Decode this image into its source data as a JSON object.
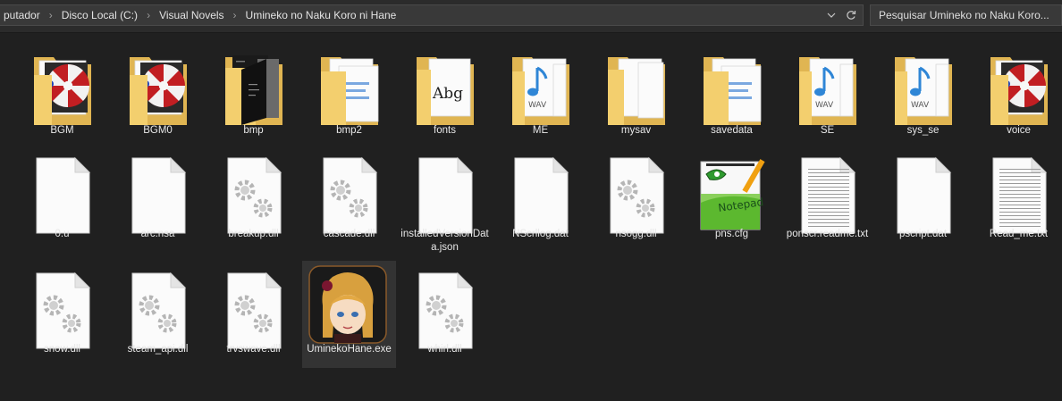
{
  "breadcrumb": {
    "items": [
      "putador",
      "Disco Local (C:)",
      "Visual Novels",
      "Umineko no Naku Koro ni Hane"
    ]
  },
  "search": {
    "placeholder": "Pesquisar Umineko no Naku Koro..."
  },
  "files": [
    {
      "name": "BGM",
      "type": "folder-app"
    },
    {
      "name": "BGM0",
      "type": "folder-app"
    },
    {
      "name": "bmp",
      "type": "folder-dark"
    },
    {
      "name": "bmp2",
      "type": "folder-docs"
    },
    {
      "name": "fonts",
      "type": "folder-font"
    },
    {
      "name": "ME",
      "type": "folder-wav"
    },
    {
      "name": "mysav",
      "type": "folder-plain"
    },
    {
      "name": "savedata",
      "type": "folder-docs"
    },
    {
      "name": "SE",
      "type": "folder-wav"
    },
    {
      "name": "sys_se",
      "type": "folder-wav"
    },
    {
      "name": "voice",
      "type": "folder-app"
    },
    {
      "name": "0.u",
      "type": "blank"
    },
    {
      "name": "arc.nsa",
      "type": "blank"
    },
    {
      "name": "breakup.dll",
      "type": "dll"
    },
    {
      "name": "cascade.dll",
      "type": "dll"
    },
    {
      "name": "installedVersionData.json",
      "type": "blank"
    },
    {
      "name": "NScrllog.dat",
      "type": "blank"
    },
    {
      "name": "nsogg.dll",
      "type": "dll"
    },
    {
      "name": "pns.cfg",
      "type": "notepad"
    },
    {
      "name": "ponscr.readme.txt",
      "type": "text"
    },
    {
      "name": "pscript.dat",
      "type": "blank"
    },
    {
      "name": "Read_me.txt",
      "type": "text"
    },
    {
      "name": "snow.dll",
      "type": "dll"
    },
    {
      "name": "steam_api.dll",
      "type": "dll"
    },
    {
      "name": "trvswave.dll",
      "type": "dll"
    },
    {
      "name": "UminekoHane.exe",
      "type": "exe"
    },
    {
      "name": "whirl.dll",
      "type": "dll"
    }
  ],
  "selected": "UminekoHane.exe",
  "colors": {
    "background": "#202020",
    "folder": "#f2cd6b",
    "selection": "#333333"
  }
}
